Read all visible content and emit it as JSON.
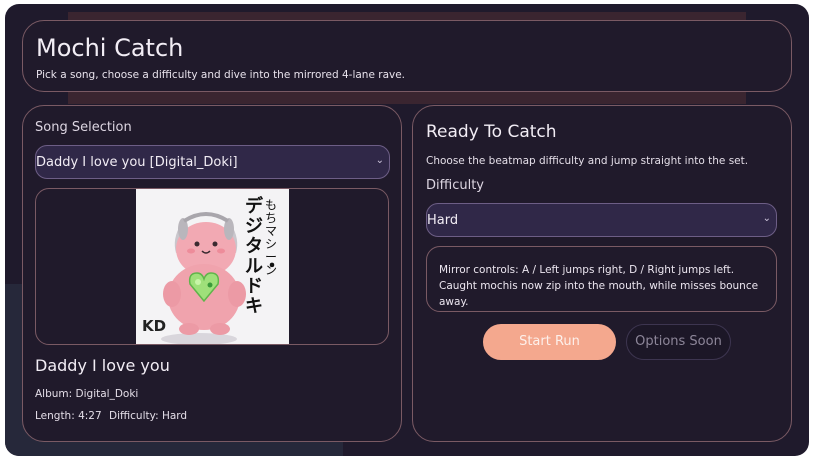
{
  "header": {
    "title": "Mochi Catch",
    "subtitle": "Pick a song, choose a difficulty and dive into the mirrored 4-lane rave."
  },
  "song_panel": {
    "section_label": "Song Selection",
    "song_select": {
      "value": "Daddy I love you  [Digital_Doki]"
    },
    "cover": {
      "vertical_text_1": "もちマシーン",
      "vertical_text_2": "デジタル・ドキ",
      "logo": "KD"
    },
    "song_title": "Daddy I love you",
    "album": "Album: Digital_Doki",
    "length": "Length: 4:27",
    "difficulty": "Difficulty: Hard"
  },
  "ready_panel": {
    "title": "Ready To Catch",
    "description": "Choose the beatmap difficulty and jump straight into the set.",
    "difficulty_label": "Difficulty",
    "difficulty_select": {
      "value": "Hard"
    },
    "mirror_info": "Mirror controls: A / Left jumps right, D / Right jumps left. Caught mochis now zip into the mouth, while misses bounce away.",
    "start_button": "Start Run",
    "options_button": "Options Soon"
  },
  "colors": {
    "background": "#1f1a2c",
    "card_border": "#7a5a64",
    "select_bg": "#302848",
    "accent": "#f4a88e"
  },
  "icons": {
    "select_chevron": "chevron-down-icon"
  }
}
